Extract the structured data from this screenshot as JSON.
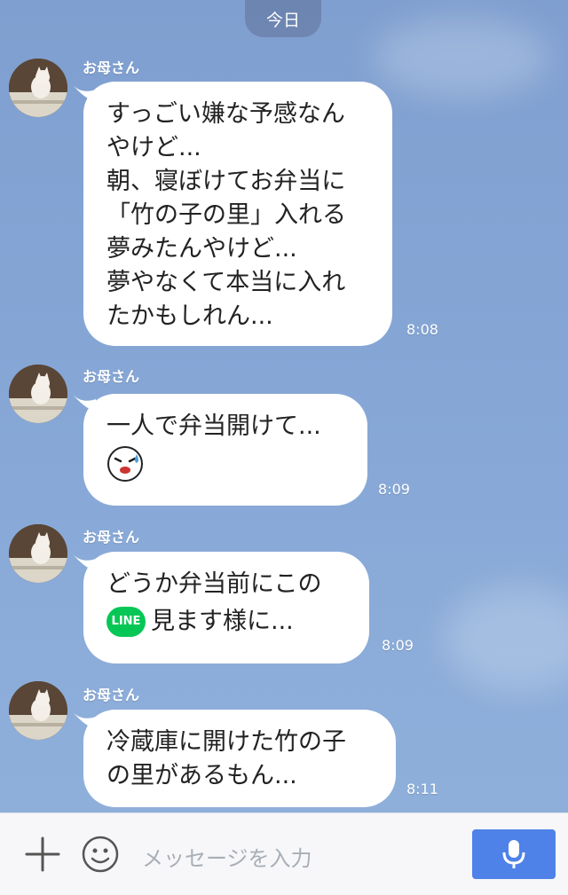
{
  "header": {
    "date_label": "今日"
  },
  "messages": [
    {
      "sender": "お母さん",
      "lines": [
        "すっごい嫌な予感なん",
        "やけど...",
        "朝、寝ぼけてお弁当に",
        "「竹の子の里」入れる",
        "夢みたんやけど...",
        "夢やなくて本当に入れ",
        "たかもしれん..."
      ],
      "time": "8:08"
    },
    {
      "sender": "お母さん",
      "lines": [
        "一人で弁当開けて..."
      ],
      "emoji": "sweating-face-emoji",
      "time": "8:09"
    },
    {
      "sender": "お母さん",
      "lines": [
        "どうか弁当前にこの"
      ],
      "badge": "LINE",
      "tail_text": "見ます様に...",
      "time": "8:09"
    },
    {
      "sender": "お母さん",
      "lines": [
        "冷蔵庫に開けた竹の子",
        "の里があるもん..."
      ],
      "time": "8:11"
    }
  ],
  "input": {
    "placeholder": "メッセージを入力"
  },
  "icons": {
    "plus": "plus-icon",
    "emoji": "smile-icon",
    "mic": "mic-icon"
  }
}
